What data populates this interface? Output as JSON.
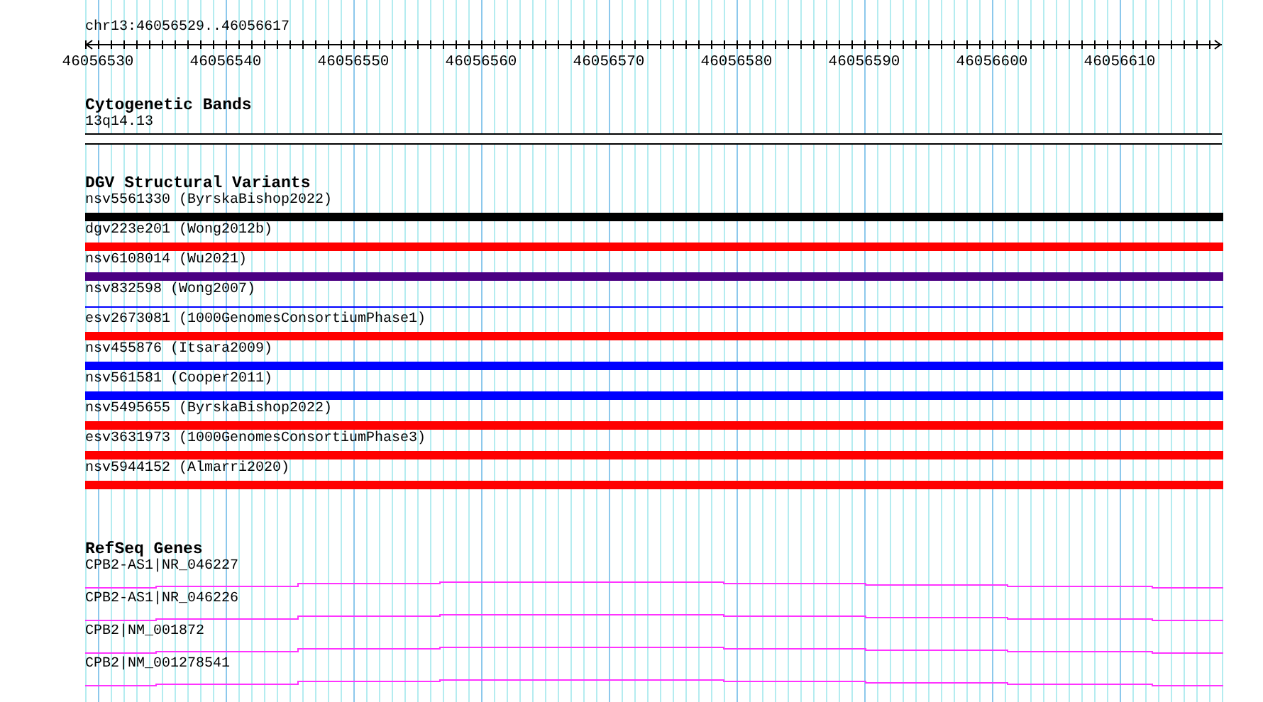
{
  "location": "chr13:46056529..46056617",
  "ruler": {
    "ticks": [
      "46056530",
      "46056540",
      "46056550",
      "46056560",
      "46056570",
      "46056580",
      "46056590",
      "46056600",
      "46056610"
    ]
  },
  "tracks": [
    {
      "kind": "cytoband",
      "title": "Cytogenetic Bands",
      "features": [
        {
          "label": "13q14.13"
        }
      ]
    },
    {
      "kind": "variants",
      "title": "DGV Structural Variants",
      "features": [
        {
          "label": "nsv5561330 (ByrskaBishop2022)",
          "color": "#000000",
          "kind": "thick"
        },
        {
          "label": "dgv223e201 (Wong2012b)",
          "color": "#ff0000",
          "kind": "thick"
        },
        {
          "label": "nsv6108014 (Wu2021)",
          "color": "#4b0082",
          "kind": "thick"
        },
        {
          "label": "nsv832598 (Wong2007)",
          "color": "#0000ff",
          "kind": "thin"
        },
        {
          "label": "esv2673081 (1000GenomesConsortiumPhase1)",
          "color": "#ff0000",
          "kind": "thick"
        },
        {
          "label": "nsv455876 (Itsara2009)",
          "color": "#0000ff",
          "kind": "thick"
        },
        {
          "label": "nsv561581 (Cooper2011)",
          "color": "#0000ff",
          "kind": "thick"
        },
        {
          "label": "nsv5495655 (ByrskaBishop2022)",
          "color": "#ff0000",
          "kind": "thick"
        },
        {
          "label": "esv3631973 (1000GenomesConsortiumPhase3)",
          "color": "#ff0000",
          "kind": "thick"
        },
        {
          "label": "nsv5944152 (Almarri2020)",
          "color": "#ff0000",
          "kind": "thick"
        }
      ]
    },
    {
      "kind": "genes",
      "title": "RefSeq Genes",
      "features": [
        {
          "label": "CPB2-AS1|NR_046227"
        },
        {
          "label": "CPB2-AS1|NR_046226"
        },
        {
          "label": "CPB2|NM_001872"
        },
        {
          "label": "CPB2|NM_001278541"
        }
      ]
    }
  ]
}
